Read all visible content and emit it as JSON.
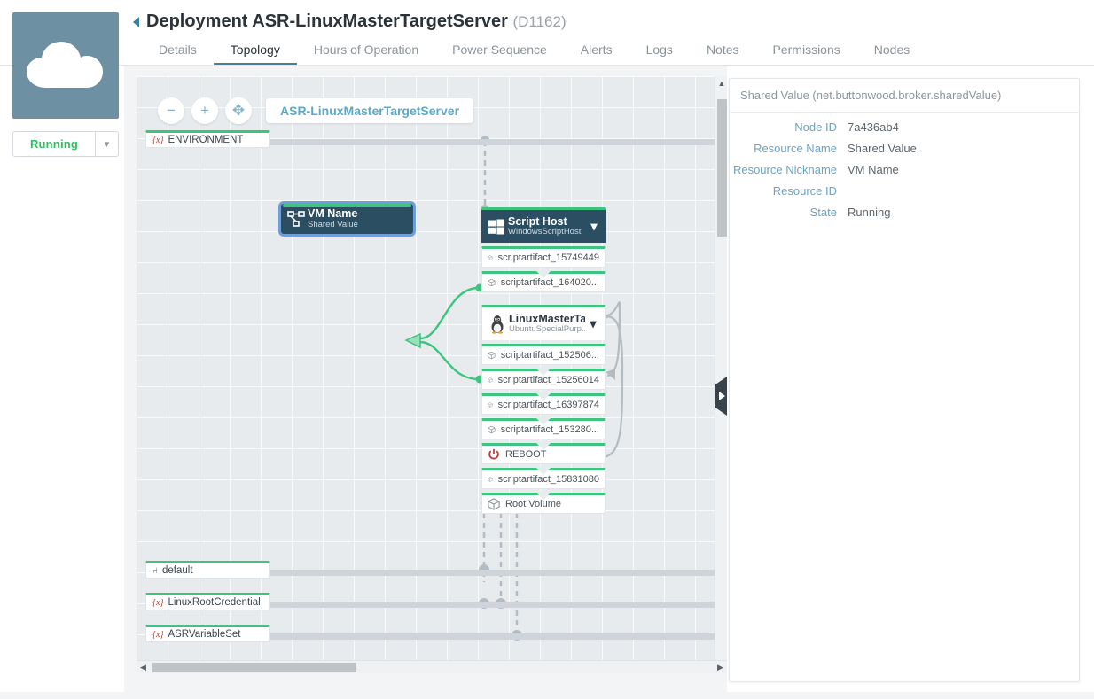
{
  "header": {
    "back_icon": "back-caret-icon",
    "title": "Deployment ASR-LinuxMasterTargetServer",
    "id": "(D1162)",
    "tabs": [
      {
        "label": "Details",
        "active": false
      },
      {
        "label": "Topology",
        "active": true
      },
      {
        "label": "Hours of Operation",
        "active": false
      },
      {
        "label": "Power Sequence",
        "active": false
      },
      {
        "label": "Alerts",
        "active": false
      },
      {
        "label": "Logs",
        "active": false
      },
      {
        "label": "Notes",
        "active": false
      },
      {
        "label": "Permissions",
        "active": false
      },
      {
        "label": "Nodes",
        "active": false
      }
    ]
  },
  "sidebar": {
    "thumbnail_icon": "cloud-icon",
    "status": "Running",
    "status_color": "#2fbf63",
    "status_caret_icon": "chevron-down-icon"
  },
  "canvas": {
    "toolbar": {
      "zoom_out_label": "−",
      "zoom_in_label": "+",
      "pan_label": "✥",
      "name_chip": "ASR-LinuxMasterTargetServer"
    },
    "lanes": [
      {
        "label": "ENVIRONMENT",
        "icon": "variable-icon",
        "icon_glyph": "{x}",
        "kind": "var"
      },
      {
        "label": "default",
        "icon": "network-icon",
        "icon_glyph": "⑁",
        "kind": "net"
      },
      {
        "label": "LinuxRootCredential",
        "icon": "variable-icon",
        "icon_glyph": "{x}",
        "kind": "var"
      },
      {
        "label": "ASRVariableSet",
        "icon": "variable-icon",
        "icon_glyph": "{x}",
        "kind": "var"
      }
    ],
    "vm_node": {
      "title": "VM Name",
      "subtitle": "Shared Value",
      "icon": "shared-value-icon"
    },
    "script_host": {
      "title": "Script Host",
      "subtitle": "WindowsScriptHost",
      "icon": "windows-icon",
      "chevron_icon": "chevron-down-icon",
      "artifacts": [
        {
          "label": "scriptartifact_15749449",
          "icon": "package-icon"
        },
        {
          "label": "scriptartifact_164020...",
          "icon": "package-icon"
        }
      ]
    },
    "linux_host": {
      "title": "LinuxMasterTar...",
      "subtitle": "UbuntuSpecialPurp...",
      "icon": "linux-penguin-icon",
      "chevron_icon": "chevron-down-icon",
      "artifacts": [
        {
          "label": "scriptartifact_152506...",
          "icon": "package-icon"
        },
        {
          "label": "scriptartifact_15256014",
          "icon": "package-icon"
        },
        {
          "label": "scriptartifact_16397874",
          "icon": "package-icon"
        },
        {
          "label": "scriptartifact_153280...",
          "icon": "package-icon"
        },
        {
          "label": "REBOOT",
          "icon": "power-icon"
        },
        {
          "label": "scriptartifact_15831080",
          "icon": "package-icon"
        },
        {
          "label": "Root Volume",
          "icon": "package-icon"
        }
      ]
    },
    "scroll": {
      "up_arrow": "▲",
      "down_arrow": "▼",
      "left_arrow": "◀",
      "right_arrow": "▶"
    },
    "collapse_handle_icon": "panel-collapse-icon"
  },
  "detail_panel": {
    "title": "Shared Value (net.buttonwood.broker.sharedValue)",
    "rows": [
      {
        "label": "Node ID",
        "value": "7a436ab4"
      },
      {
        "label": "Resource Name",
        "value": "Shared Value"
      },
      {
        "label": "Resource Nickname",
        "value": "VM Name"
      },
      {
        "label": "Resource ID",
        "value": ""
      },
      {
        "label": "State",
        "value": "Running"
      }
    ]
  }
}
